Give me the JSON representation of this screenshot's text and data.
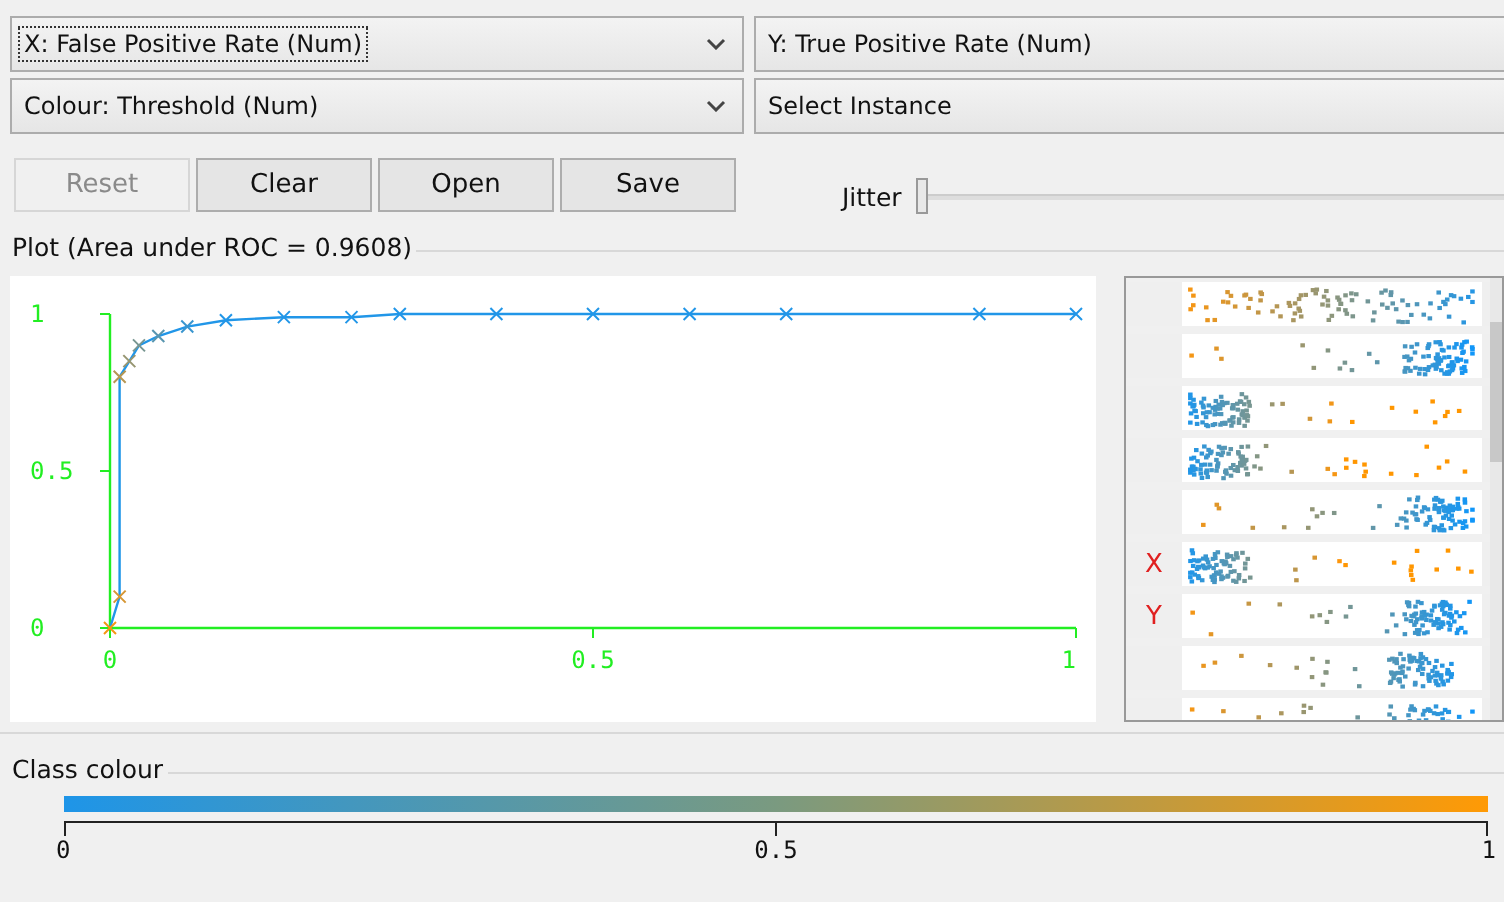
{
  "selectors": [
    {
      "text": "X: False Positive Rate (Num)",
      "dropdown": true,
      "focused": true
    },
    {
      "text": "Y: True Positive Rate (Num)",
      "dropdown": false,
      "focused": false
    },
    {
      "text": "Colour: Threshold (Num)",
      "dropdown": true,
      "focused": false
    },
    {
      "text": "Select Instance",
      "dropdown": false,
      "focused": false
    }
  ],
  "buttons": [
    {
      "label": "Reset",
      "disabled": true
    },
    {
      "label": "Clear",
      "disabled": false
    },
    {
      "label": "Open",
      "disabled": false
    },
    {
      "label": "Save",
      "disabled": false
    }
  ],
  "jitter": {
    "label": "Jitter",
    "level": 0
  },
  "plot": {
    "title": "Plot (Area under ROC = 0.9608)",
    "chart_data": {
      "type": "line",
      "x": [
        0,
        0.01,
        0.01,
        0.02,
        0.03,
        0.05,
        0.08,
        0.12,
        0.18,
        0.25,
        0.3,
        0.4,
        0.5,
        0.6,
        0.7,
        0.9,
        1
      ],
      "series": [
        {
          "color": "#2196e8",
          "marker": "x",
          "values": [
            0,
            0.1,
            0.8,
            0.85,
            0.9,
            0.93,
            0.96,
            0.98,
            0.99,
            0.99,
            1,
            1,
            1,
            1,
            1,
            1,
            1
          ]
        }
      ],
      "xlim": [
        0,
        1
      ],
      "ylim": [
        0,
        1
      ],
      "xticks": [
        0,
        0.5,
        1
      ],
      "yticks": [
        0,
        0.5,
        1
      ]
    }
  },
  "attribute_panel": {
    "x_label": "X",
    "y_label": "Y",
    "strips": [
      {
        "kind": "plain"
      },
      {
        "kind": "plain"
      },
      {
        "kind": "plain"
      },
      {
        "kind": "plain"
      },
      {
        "kind": "plain"
      },
      {
        "kind": "x_axis"
      },
      {
        "kind": "y_axis"
      },
      {
        "kind": "plain"
      },
      {
        "kind": "plain"
      }
    ]
  },
  "class_colour": {
    "title": "Class colour",
    "ticks": [
      "0",
      "0.5",
      "1"
    ]
  }
}
